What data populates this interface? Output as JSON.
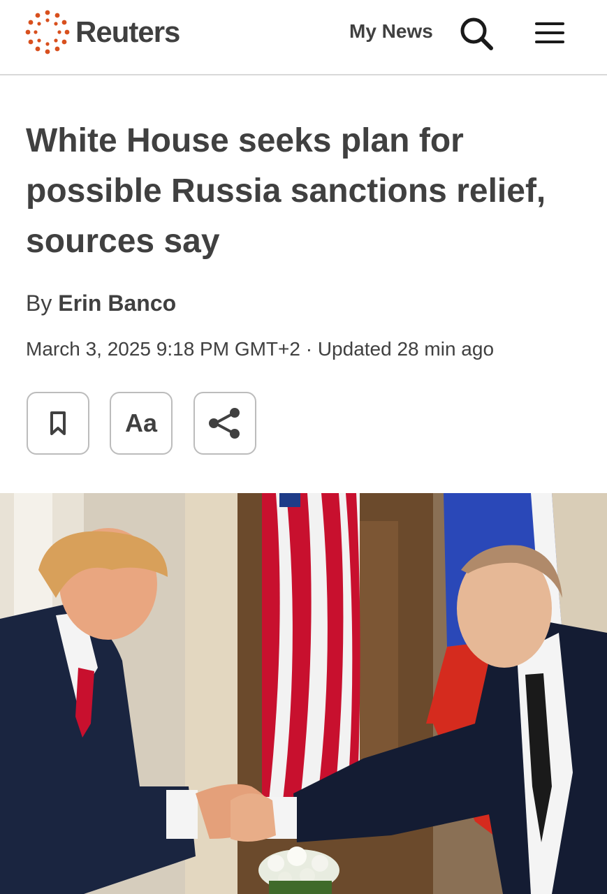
{
  "header": {
    "brand": "Reuters",
    "my_news_label": "My News",
    "icons": [
      "reuters-logo",
      "search-icon",
      "menu-icon"
    ]
  },
  "article": {
    "headline": "White House seeks plan for possible Russia sanctions relief, sources say",
    "byline_prefix": "By",
    "author": "Erin Banco",
    "dateline": "March 3, 2025 9:18 PM GMT+2 · Updated 28 min ago",
    "text_size_label": "Aa",
    "actions": [
      "bookmark-icon",
      "text-size-button",
      "share-icon"
    ]
  },
  "colors": {
    "brand_orange": "#d8501e",
    "text": "#404040",
    "border": "#bcbcbc"
  }
}
